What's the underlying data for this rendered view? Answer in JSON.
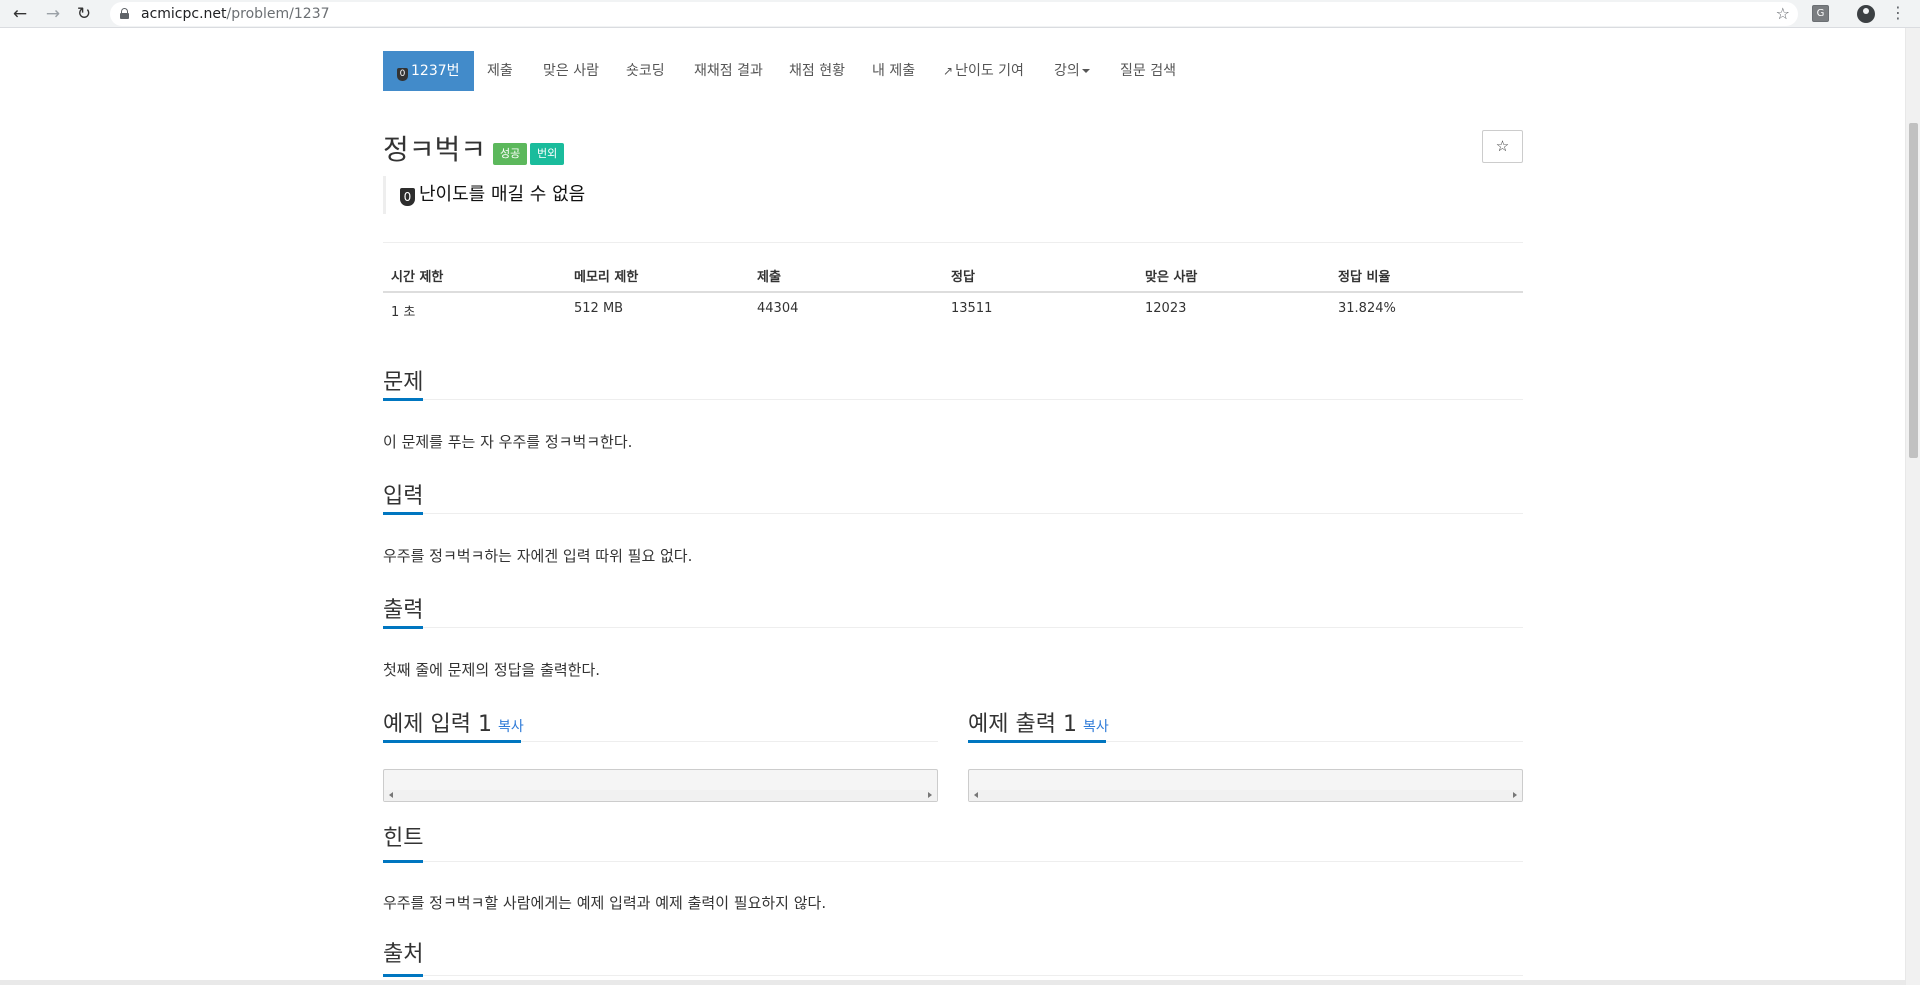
{
  "browser": {
    "url_domain": "acmicpc.net",
    "url_path": "/problem/1237",
    "ext_letter": "G"
  },
  "menu": {
    "problem_tier": "0",
    "problem_number": "1237번",
    "items": [
      "제출",
      "맞은 사람",
      "숏코딩",
      "재채점 결과",
      "채점 현황",
      "내 제출",
      "난이도 기여",
      "강의",
      "질문 검색"
    ]
  },
  "problem": {
    "title": "정ㅋ벅ㅋ",
    "labels": [
      "성공",
      "번외"
    ],
    "tier_icon": "0",
    "tier_text": "난이도를 매길 수 없음"
  },
  "info_table": {
    "headers": [
      "시간 제한",
      "메모리 제한",
      "제출",
      "정답",
      "맞은 사람",
      "정답 비율"
    ],
    "values": [
      "1 초",
      "512 MB",
      "44304",
      "13511",
      "12023",
      "31.824%"
    ]
  },
  "sections": {
    "description": {
      "title": "문제",
      "text": "이 문제를 푸는 자 우주를 정ㅋ벅ㅋ한다."
    },
    "input": {
      "title": "입력",
      "text": "우주를 정ㅋ벅ㅋ하는 자에겐 입력 따위 필요 없다."
    },
    "output": {
      "title": "출력",
      "text": "첫째 줄에 문제의 정답을 출력한다."
    },
    "sample_input": {
      "title": "예제 입력 1",
      "copy": "복사",
      "content": ""
    },
    "sample_output": {
      "title": "예제 출력 1",
      "copy": "복사",
      "content": ""
    },
    "hint": {
      "title": "힌트",
      "text": "우주를 정ㅋ벅ㅋ할 사람에게는 예제 입력과 예제 출력이 필요하지 않다."
    },
    "source": {
      "title": "출처"
    }
  }
}
